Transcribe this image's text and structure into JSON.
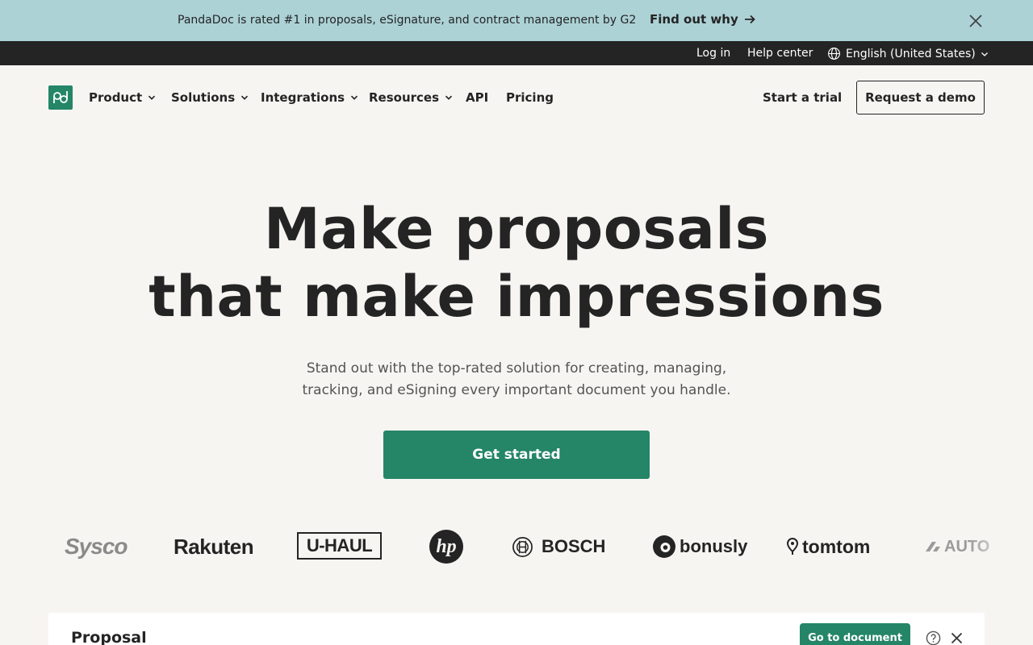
{
  "promo": {
    "text": "PandaDoc is rated #1 in proposals, eSignature, and contract management by G2",
    "link_label": "Find out why",
    "link_icon": "arrow-right-icon",
    "close_icon": "close-icon"
  },
  "utility": {
    "login": "Log in",
    "help": "Help center",
    "language": "English (United States)",
    "language_icon": "globe-icon"
  },
  "nav": {
    "logo_icon": "pandadoc-logo-icon",
    "items": [
      {
        "label": "Product",
        "dropdown": true
      },
      {
        "label": "Solutions",
        "dropdown": true
      },
      {
        "label": "Integrations",
        "dropdown": true
      },
      {
        "label": "Resources",
        "dropdown": true
      },
      {
        "label": "API",
        "dropdown": false
      },
      {
        "label": "Pricing",
        "dropdown": false
      }
    ],
    "trial": "Start a trial",
    "demo": "Request a demo"
  },
  "hero": {
    "title_line1": "Make proposals",
    "title_line2": "that make impressions",
    "subtitle_line1": "Stand out with the top-rated solution for creating, managing,",
    "subtitle_line2": "tracking, and eSigning every important document you handle.",
    "cta": "Get started"
  },
  "logos": {
    "sysco": "Sysco",
    "rakuten": "Rakuten",
    "uhaul": "U-HAUL",
    "hp": "hp",
    "bosch": "BOSCH",
    "bonusly": "bonusly",
    "tomtom": "tomtom",
    "auto": "AUTO"
  },
  "card": {
    "title": "Proposal",
    "button": "Go to document",
    "help_icon": "help-circle-icon",
    "close_icon": "close-icon"
  },
  "colors": {
    "promo_bg": "#acd2d6",
    "utility_bg": "#242424",
    "page_bg": "#f7f5f2",
    "brand_green": "#248567",
    "text": "#242424"
  }
}
